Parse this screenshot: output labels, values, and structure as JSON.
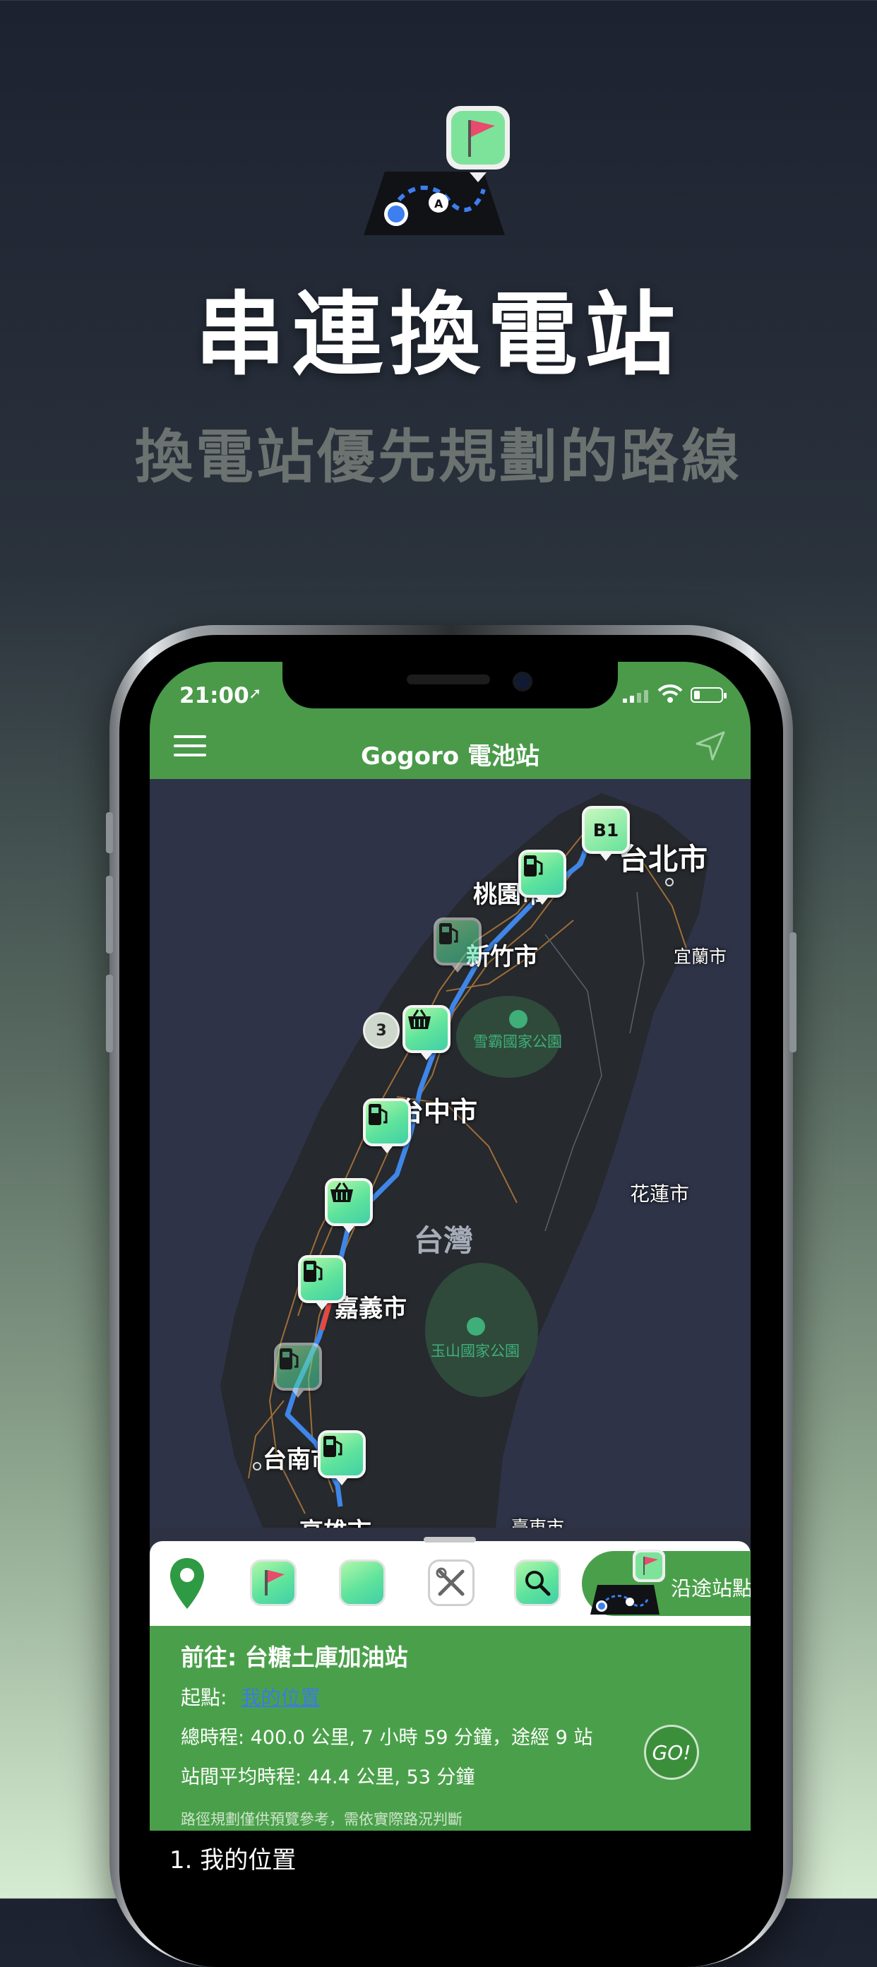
{
  "hero": {
    "title": "串連換電站",
    "subtitle": "換電站優先規劃的路線"
  },
  "status_bar": {
    "time": "21:00"
  },
  "nav": {
    "title": "Gogoro 電池站",
    "menu_icon": "hamburger-icon",
    "action_icon": "navigation-arrow-icon"
  },
  "map": {
    "cities": {
      "taipei": "台北市",
      "taoyuan": "桃園市",
      "hsinchu": "新竹市",
      "yilan": "宜蘭市",
      "taichung": "台中市",
      "hualien": "花蓮市",
      "taiwan": "台灣",
      "chiayi": "嘉義市",
      "tainan": "台南市",
      "kaohsiung": "高雄市",
      "taitung": "臺東市"
    },
    "parks": {
      "shei_pa": "雪霸國家公園",
      "yushan": "玉山國家公園"
    },
    "marker_b1": "B1",
    "cluster_count": "3",
    "colors": {
      "route": "#3f86e8",
      "route_alert": "#e6483f",
      "land": "#272a2e",
      "sea": "#2e3348"
    }
  },
  "toolbar": {
    "location_icon": "map-pin-icon",
    "route_label": "沿途站點"
  },
  "route_info": {
    "destination": "前往: 台糖土庫加油站",
    "start_label": "起點:",
    "start_value": "我的位置",
    "total": "總時程: 400.0 公里, 7 小時 59 分鐘，途經 9 站",
    "average": "站間平均時程: 44.4 公里, 53 分鐘",
    "note": "路徑規劃僅供預覽參考，需依實際路況判斷",
    "go_label": "GO!"
  },
  "list": {
    "first_item": "1. 我的位置"
  },
  "theme": {
    "accent_green": "#4aa04a",
    "marker_gradient": "#5fe39c"
  }
}
